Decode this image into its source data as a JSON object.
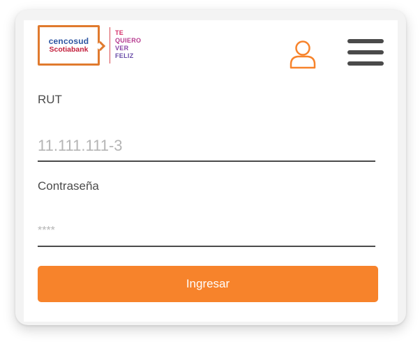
{
  "brand": {
    "logo_line1": "cencosud",
    "logo_line2": "Scotiabank",
    "slogan": [
      "TE",
      "QUIERO",
      "VER",
      "FELIZ"
    ],
    "colors": {
      "accent": "#f7832b",
      "logo_border": "#e07a2e",
      "logo_blue": "#2d55a2",
      "logo_red": "#c31f3c"
    }
  },
  "header": {
    "user_icon": "user-icon",
    "menu_icon": "hamburger-menu-icon"
  },
  "form": {
    "rut": {
      "label": "RUT",
      "value": "",
      "placeholder": "11.111.111-3"
    },
    "password": {
      "label": "Contraseña",
      "value": "",
      "placeholder": "****"
    },
    "submit_label": "Ingresar"
  }
}
